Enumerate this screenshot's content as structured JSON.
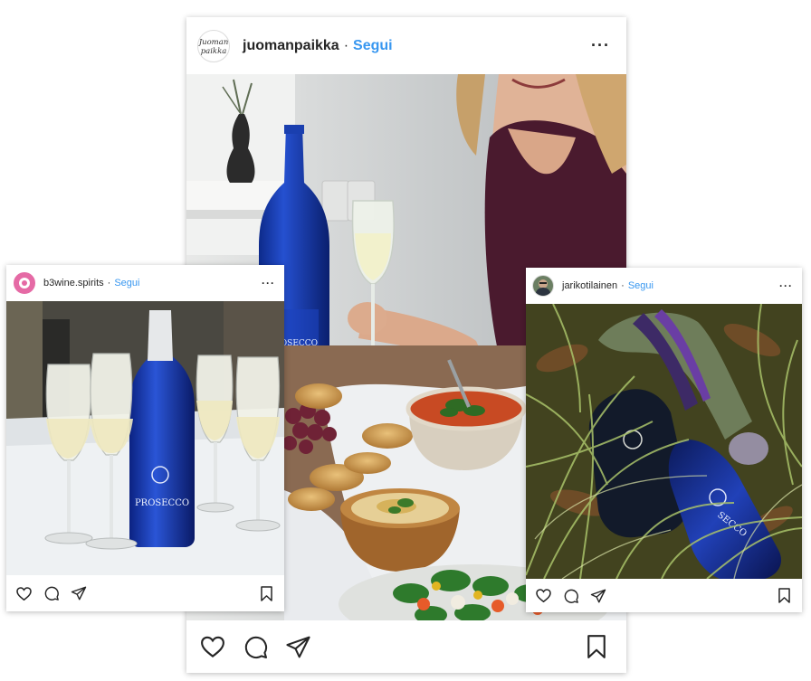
{
  "posts": {
    "main": {
      "avatar_text": [
        "Juoman",
        "paikka"
      ],
      "username": "juomanpaikka",
      "separator": "·",
      "follow_label": "Segui",
      "more_label": "···",
      "photo_labels": [
        "PROSECCO"
      ]
    },
    "left": {
      "username": "b3wine.spirits",
      "separator": "·",
      "follow_label": "Segui",
      "more_label": "···",
      "photo_labels": [
        "PROSECCO"
      ]
    },
    "right": {
      "username": "jarikotilainen",
      "separator": "·",
      "follow_label": "Segui",
      "more_label": "···",
      "photo_labels": [
        "SECCO"
      ]
    }
  },
  "icons": [
    "heart-icon",
    "comment-icon",
    "share-icon",
    "bookmark-icon",
    "more-options-icon"
  ],
  "colors": {
    "follow_blue": "#3897f0",
    "text_dark": "#262626",
    "bottle_blue": "#1a3fb0",
    "b3wine_avatar": "#e56aa5",
    "wall": "#d4d6d6",
    "table_linen": "#eef0f2",
    "grass": "#3d4a1e"
  }
}
